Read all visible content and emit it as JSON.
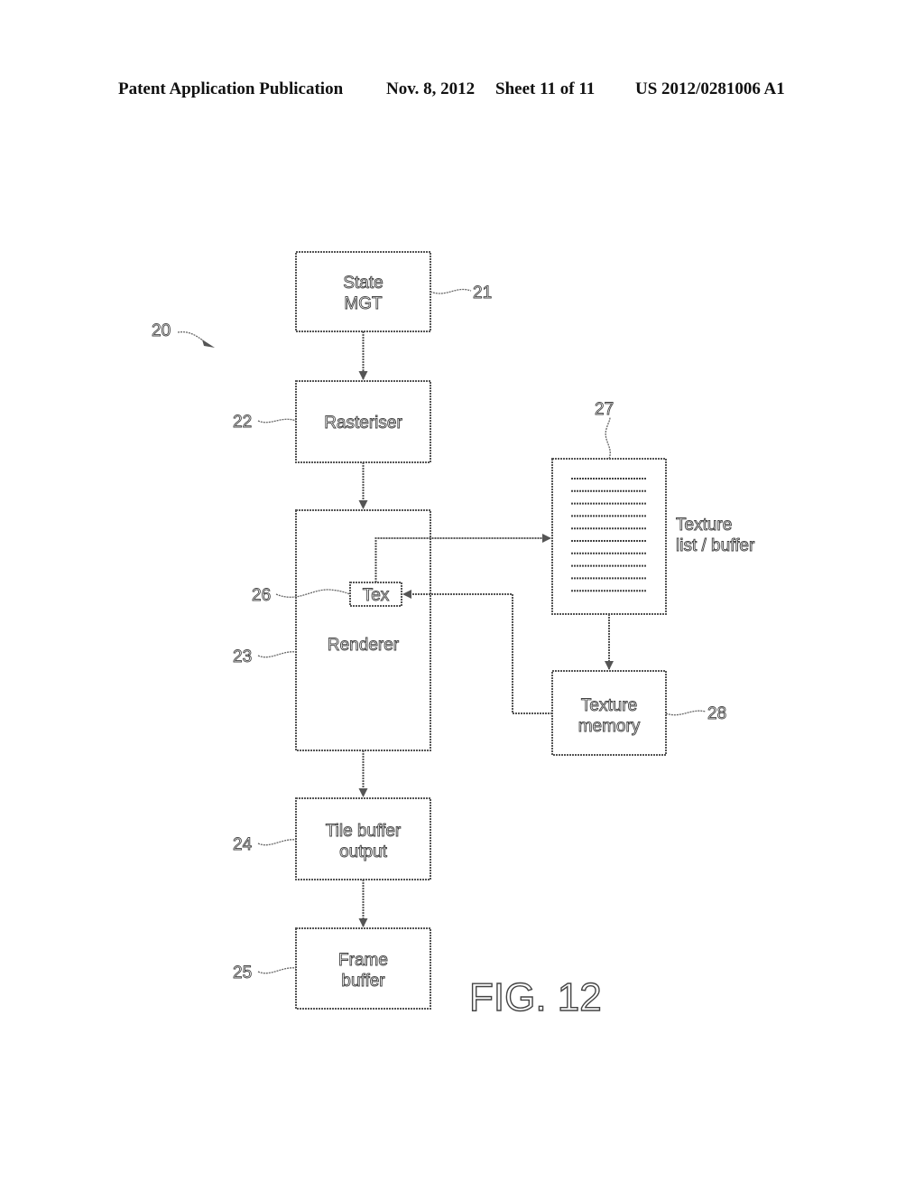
{
  "header": {
    "publication": "Patent Application Publication",
    "date": "Nov. 8, 2012",
    "sheet": "Sheet 11 of 11",
    "number": "US 2012/0281006 A1"
  },
  "figure": {
    "label": "FIG. 12",
    "system_ref": "20",
    "blocks": [
      {
        "id": "state-mgt",
        "ref": "21",
        "lines": [
          "State",
          "MGT"
        ]
      },
      {
        "id": "rasteriser",
        "ref": "22",
        "lines": [
          "Rasteriser"
        ]
      },
      {
        "id": "renderer",
        "ref": "23",
        "lines": [
          "Renderer"
        ]
      },
      {
        "id": "tile-buffer-output",
        "ref": "24",
        "lines": [
          "Tile buffer",
          "output"
        ]
      },
      {
        "id": "frame-buffer",
        "ref": "25",
        "lines": [
          "Frame",
          "buffer"
        ]
      },
      {
        "id": "tex",
        "ref": "26",
        "lines": [
          "Tex"
        ]
      },
      {
        "id": "texture-list-buffer",
        "ref": "27",
        "lines": [
          "Texture",
          "list / buffer"
        ],
        "list_line_count": 10
      },
      {
        "id": "texture-memory",
        "ref": "28",
        "lines": [
          "Texture",
          "memory"
        ]
      }
    ]
  }
}
